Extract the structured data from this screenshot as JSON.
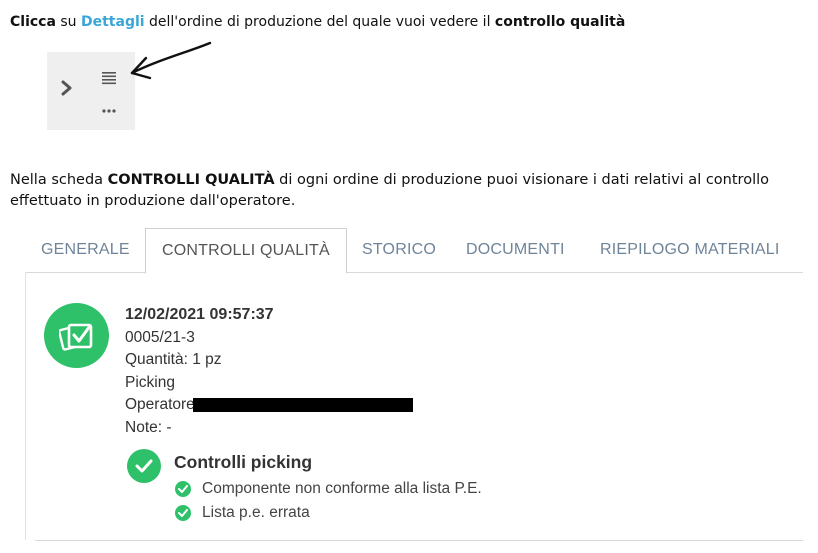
{
  "instruction1": {
    "bold_start": "Clicca",
    "text1": " su ",
    "link": "Dettagli",
    "text2": " dell'ordine di produzione del quale vuoi vedere il ",
    "bold_end": "controllo qualità"
  },
  "instruction2": {
    "text1": "Nella scheda ",
    "bold": "CONTROLLI QUALITÀ",
    "text2": " di ogni ordine di produzione puoi visionare i dati relativi al controllo effettuato in produzione dall'operatore."
  },
  "action_icons": [
    "chevron-right-icon",
    "list-icon",
    "more-dots-icon"
  ],
  "tabs": [
    {
      "label": "GENERALE"
    },
    {
      "label": "CONTROLLI QUALITÀ"
    },
    {
      "label": "STORICO"
    },
    {
      "label": "DOCUMENTI"
    },
    {
      "label": "RIEPILOGO MATERIALI"
    }
  ],
  "active_tab": "CONTROLLI QUALITÀ",
  "entry": {
    "datetime": "12/02/2021 09:57:37",
    "order": "0005/21-3",
    "quantity": "Quantità: 1 pz",
    "phase": "Picking",
    "operator_label": "Operatore",
    "note": "Note: -"
  },
  "controls": {
    "title": "Controlli picking",
    "items": [
      "Componente non conforme alla lista P.E.",
      "Lista p.e. errata"
    ]
  },
  "colors": {
    "link": "#3aa6d8",
    "success": "#2fc16a",
    "tab_text": "#6f8499"
  }
}
